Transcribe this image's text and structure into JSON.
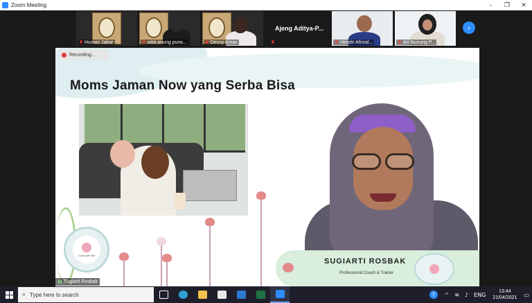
{
  "window": {
    "title": "Zoom Meeting",
    "controls": {
      "minimize": "–",
      "maximize": "❐",
      "close": "✕"
    }
  },
  "participants": [
    {
      "name": "Humas Jabar",
      "muted": true
    },
    {
      "name": "wita.anung purw...",
      "muted": true
    },
    {
      "name": "Dessy Amas",
      "muted": true
    },
    {
      "name": "Ajeng Aditya-P...",
      "muted": true
    },
    {
      "name": "Hendri Afrizal...",
      "muted": true
    },
    {
      "name": "Ari Nunung P...",
      "muted": true
    }
  ],
  "strip_next_icon": "chevron-right-icon",
  "recording": {
    "label": "Recording..."
  },
  "slide": {
    "title": "Moms Jaman Now yang Serba Bisa",
    "speaker_name": "SUGIARTI ROSBAK",
    "speaker_role": "Professional Coach & Trainer",
    "logo_text": "Grow with Me"
  },
  "self_view": {
    "name": "Sugiarti Rosbak"
  },
  "taskbar": {
    "search_placeholder": "Type here to search",
    "language": "ENG",
    "time": "13:44",
    "date": "21/04/2021",
    "help": "?"
  },
  "colors": {
    "zoom_blue": "#2d8cff",
    "mute_red": "#ff3b30",
    "banner_green": "#d9eedd"
  }
}
